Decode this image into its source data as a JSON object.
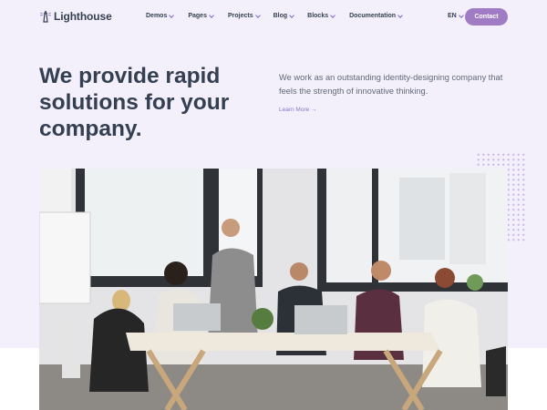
{
  "brand": {
    "name": "Lighthouse",
    "icon": "lighthouse-icon"
  },
  "nav": {
    "items": [
      {
        "label": "Demos"
      },
      {
        "label": "Pages"
      },
      {
        "label": "Projects"
      },
      {
        "label": "Blog"
      },
      {
        "label": "Blocks"
      },
      {
        "label": "Documentation"
      }
    ],
    "language": "EN",
    "contact_label": "Contact"
  },
  "hero": {
    "title": "We provide rapid solutions for your company.",
    "description": "We work as an outstanding identity-designing company that feels the strength of innovative thinking.",
    "link_label": "Learn More →"
  },
  "colors": {
    "accent": "#a07cc5",
    "text": "#343f52",
    "background": "#f3f0fb"
  }
}
